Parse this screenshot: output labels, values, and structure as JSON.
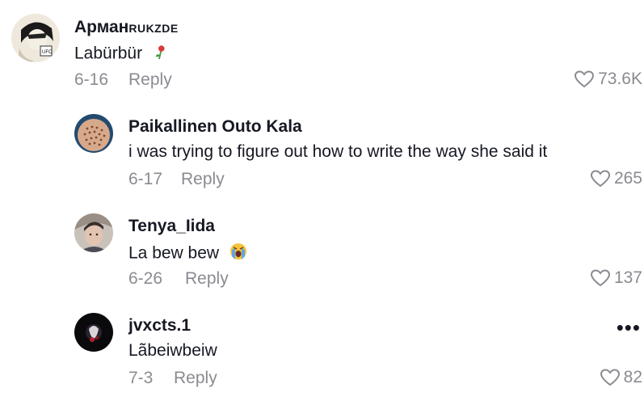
{
  "comments": [
    {
      "name": "Арман",
      "name_tag": "RUKZDE",
      "text": "Labürbür",
      "emoji": "rose-icon",
      "date": "6-16",
      "reply_label": "Reply",
      "likes": "73.6K"
    },
    {
      "name": "Paikallinen Outo Kala",
      "text": "i was trying to figure out how to write the way she said it",
      "date": "6-17",
      "reply_label": "Reply",
      "likes": "265"
    },
    {
      "name": "Tenya_Iida",
      "text": "La bew bew",
      "emoji": "crying-face-icon",
      "date": "6-26",
      "reply_label": "Reply",
      "likes": "137"
    },
    {
      "name": "jvxcts.1",
      "text": "Lãbeiwbeiw",
      "date": "7-3",
      "reply_label": "Reply",
      "likes": "82",
      "more_label": "•••"
    }
  ]
}
